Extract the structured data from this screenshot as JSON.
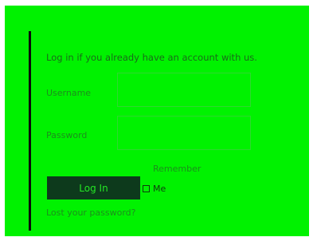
{
  "login": {
    "intro_text": "Log in if you already have an account with us.",
    "username_label": "Username",
    "username_value": "",
    "password_label": "Password",
    "password_value": "",
    "remember_label_top": "Remember",
    "remember_label_bottom": "Me",
    "remember_checked": false,
    "login_button_label": "Log In",
    "lost_password_link": "Lost your password?"
  },
  "colors": {
    "panel_background": "#00f200",
    "button_background": "#0d3a1c",
    "button_text": "#24e624",
    "rule": "#0a0a0a"
  }
}
